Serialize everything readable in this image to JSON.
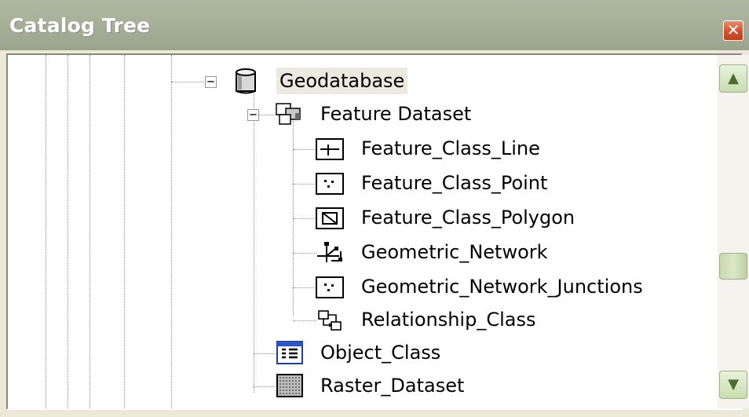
{
  "window": {
    "title": "Catalog Tree",
    "close_glyph": "✕"
  },
  "tree": {
    "geodatabase": {
      "label": "Geodatabase",
      "icon": "database-icon",
      "expander": "−"
    },
    "feature_dataset": {
      "label": "Feature Dataset",
      "icon": "feature-dataset-icon",
      "expander": "−"
    },
    "items": [
      {
        "label": "Feature_Class_Line",
        "icon": "line-feature-class-icon"
      },
      {
        "label": "Feature_Class_Point",
        "icon": "point-feature-class-icon"
      },
      {
        "label": "Feature_Class_Polygon",
        "icon": "polygon-feature-class-icon"
      },
      {
        "label": "Geometric_Network",
        "icon": "geometric-network-icon"
      },
      {
        "label": "Geometric_Network_Junctions",
        "icon": "point-feature-class-icon"
      },
      {
        "label": "Relationship_Class",
        "icon": "relationship-class-icon"
      },
      {
        "label": "Object_Class",
        "icon": "table-icon"
      },
      {
        "label": "Raster_Dataset",
        "icon": "raster-icon"
      }
    ]
  },
  "scrollbar": {
    "up_glyph": "▲",
    "down_glyph": "▼"
  },
  "colors": {
    "title_bar": "#a8b19a",
    "selection": "#ebe9e0",
    "scroll_accent": "#c8dcb0"
  }
}
